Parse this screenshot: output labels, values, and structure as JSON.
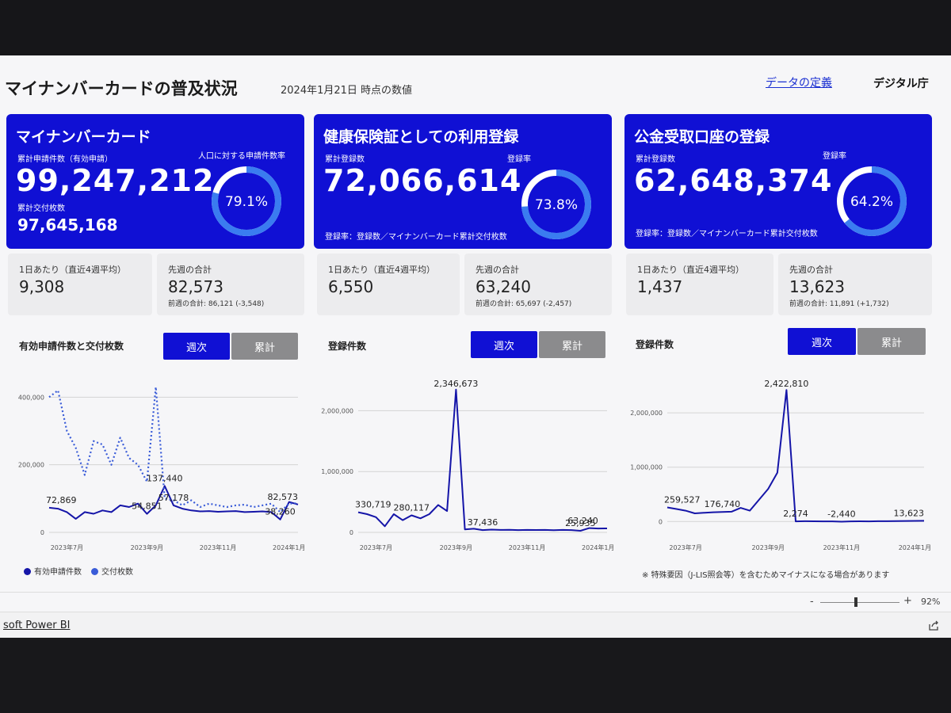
{
  "header": {
    "title": "マイナンバーカードの普及状況",
    "date": "2024年1月21日 時点の数値",
    "definition_link": "データの定義",
    "org": "デジタル庁"
  },
  "card1": {
    "title": "マイナンバーカード",
    "applications_label": "累計申請件数（有効申請）",
    "applications_value": "99,247,212",
    "issued_label": "累計交付枚数",
    "issued_value": "97,645,168",
    "rate_label": "人口に対する申請件数率",
    "rate_value": "79.1%",
    "rate": 79.1
  },
  "card2": {
    "title": "健康保険証としての利用登録",
    "registered_label": "累計登録数",
    "registered_value": "72,066,614",
    "rate_label": "登録率",
    "rate_value": "73.8%",
    "rate": 73.8,
    "note": "登録率：登録数／マイナンバーカード累計交付枚数"
  },
  "card3": {
    "title": "公金受取口座の登録",
    "registered_label": "累計登録数",
    "registered_value": "62,648,374",
    "rate_label": "登録率",
    "rate_value": "64.2%",
    "rate": 64.2,
    "note": "登録率：登録数／マイナンバーカード累計交付枚数"
  },
  "stats": [
    {
      "daily_label": "1日あたり（直近4週平均）",
      "daily_value": "9,308",
      "week_label": "先週の合計",
      "week_value": "82,573",
      "prev_week": "前週の合計: 86,121 (-3,548)"
    },
    {
      "daily_label": "1日あたり（直近4週平均）",
      "daily_value": "6,550",
      "week_label": "先週の合計",
      "week_value": "63,240",
      "prev_week": "前週の合計: 65,697 (-2,457)"
    },
    {
      "daily_label": "1日あたり（直近4週平均）",
      "daily_value": "1,437",
      "week_label": "先週の合計",
      "week_value": "13,623",
      "prev_week": "前週の合計: 11,891 (+1,732)"
    }
  ],
  "sections": [
    {
      "title": "有効申請件数と交付枚数",
      "btn_weekly": "週次",
      "btn_cumulative": "累計"
    },
    {
      "title": "登録件数",
      "btn_weekly": "週次",
      "btn_cumulative": "累計"
    },
    {
      "title": "登録件数",
      "btn_weekly": "週次",
      "btn_cumulative": "累計"
    }
  ],
  "legend": {
    "series1": "有効申請件数",
    "series2": "交付枚数"
  },
  "footnote": "※ 特殊要因（J-LIS照会等）を含むためマイナスになる場合があります",
  "zoom": {
    "minus": "-",
    "plus": "+",
    "value": "92%"
  },
  "footer": {
    "powerbi": "soft Power BI"
  },
  "colors": {
    "primary": "#1010d4",
    "inactive": "#8b8b8d",
    "ring_track": "#ffffff",
    "ring_fill": "#3a7cf0"
  },
  "chart_data": [
    {
      "type": "line",
      "title": "有効申請件数と交付枚数",
      "ylim": [
        0,
        450000
      ],
      "yticks": [
        0,
        200000,
        400000
      ],
      "ytick_labels": [
        "0",
        "200,000",
        "400,000"
      ],
      "xtick_labels": [
        {
          "label": "2023年7月",
          "at": 2
        },
        {
          "label": "2023年9月",
          "at": 11
        },
        {
          "label": "2023年11月",
          "at": 19
        },
        {
          "label": "2024年1月",
          "at": 27
        }
      ],
      "series": [
        {
          "name": "有効申請件数",
          "style": "solid",
          "values": [
            72869,
            70000,
            60000,
            40000,
            60000,
            55000,
            65000,
            60000,
            80000,
            75000,
            85000,
            54851,
            80000,
            137440,
            80000,
            70000,
            65000,
            62000,
            63000,
            61000,
            62000,
            63000,
            60000,
            61000,
            62000,
            60000,
            38260,
            90000,
            82573
          ]
        },
        {
          "name": "交付枚数",
          "style": "dotted",
          "values": [
            400000,
            420000,
            300000,
            250000,
            170000,
            270000,
            260000,
            200000,
            280000,
            220000,
            200000,
            150000,
            430000,
            100000,
            95000,
            80000,
            95000,
            75000,
            85000,
            80000,
            75000,
            80000,
            82000,
            75000,
            80000,
            85000,
            60000,
            85000,
            86000
          ]
        }
      ],
      "data_labels": [
        {
          "text": "72,869",
          "at": 0,
          "series": 0
        },
        {
          "text": "54,851",
          "at": 11,
          "series": 0
        },
        {
          "text": "137,440",
          "at": 13,
          "series": 0
        },
        {
          "text": "57,178",
          "at": 14,
          "series": 0
        },
        {
          "text": "38,260",
          "at": 26,
          "series": 0
        },
        {
          "text": "82,573",
          "at": 28,
          "series": 0
        }
      ]
    },
    {
      "type": "line",
      "title": "登録件数",
      "ylim": [
        0,
        2500000
      ],
      "yticks": [
        0,
        1000000,
        2000000
      ],
      "ytick_labels": [
        "0",
        "1,000,000",
        "2,000,000"
      ],
      "xtick_labels": [
        {
          "label": "2023年7月",
          "at": 2
        },
        {
          "label": "2023年9月",
          "at": 11
        },
        {
          "label": "2023年11月",
          "at": 19
        },
        {
          "label": "2024年1月",
          "at": 27
        }
      ],
      "series": [
        {
          "name": "登録件数",
          "style": "solid",
          "values": [
            330719,
            300000,
            250000,
            100000,
            300000,
            200000,
            280117,
            230000,
            300000,
            450000,
            350000,
            2346673,
            50000,
            60000,
            37436,
            45000,
            40000,
            42000,
            38000,
            40000,
            39000,
            41000,
            37000,
            40000,
            38000,
            25935,
            70000,
            63240,
            65697
          ]
        }
      ],
      "data_labels": [
        {
          "text": "330,719",
          "at": 0,
          "series": 0
        },
        {
          "text": "280,117",
          "at": 6,
          "series": 0
        },
        {
          "text": "2,346,673",
          "at": 11,
          "series": 0
        },
        {
          "text": "37,436",
          "at": 14,
          "series": 0
        },
        {
          "text": "25,935",
          "at": 25,
          "series": 0
        },
        {
          "text": "63,240",
          "at": 27,
          "series": 0
        }
      ]
    },
    {
      "type": "line",
      "title": "登録件数",
      "ylim": [
        -200000,
        2600000
      ],
      "yticks": [
        0,
        1000000,
        2000000
      ],
      "ytick_labels": [
        "0",
        "1,000,000",
        "2,000,000"
      ],
      "xtick_labels": [
        {
          "label": "2023年7月",
          "at": 2
        },
        {
          "label": "2023年9月",
          "at": 11
        },
        {
          "label": "2023年11月",
          "at": 19
        },
        {
          "label": "2024年1月",
          "at": 27
        }
      ],
      "series": [
        {
          "name": "登録件数",
          "style": "solid",
          "values": [
            259527,
            230000,
            200000,
            150000,
            160000,
            170000,
            176740,
            180000,
            250000,
            200000,
            400000,
            600000,
            900000,
            2422810,
            2274,
            5000,
            4000,
            3000,
            2000,
            -2440,
            3000,
            4000,
            3000,
            5000,
            6000,
            8000,
            10000,
            12000,
            13623
          ]
        }
      ],
      "data_labels": [
        {
          "text": "259,527",
          "at": 0,
          "series": 0
        },
        {
          "text": "176,740",
          "at": 6,
          "series": 0
        },
        {
          "text": "2,422,810",
          "at": 13,
          "series": 0
        },
        {
          "text": "2,274",
          "at": 14,
          "series": 0
        },
        {
          "text": "-2,440",
          "at": 19,
          "series": 0
        },
        {
          "text": "13,623",
          "at": 28,
          "series": 0
        }
      ]
    }
  ]
}
